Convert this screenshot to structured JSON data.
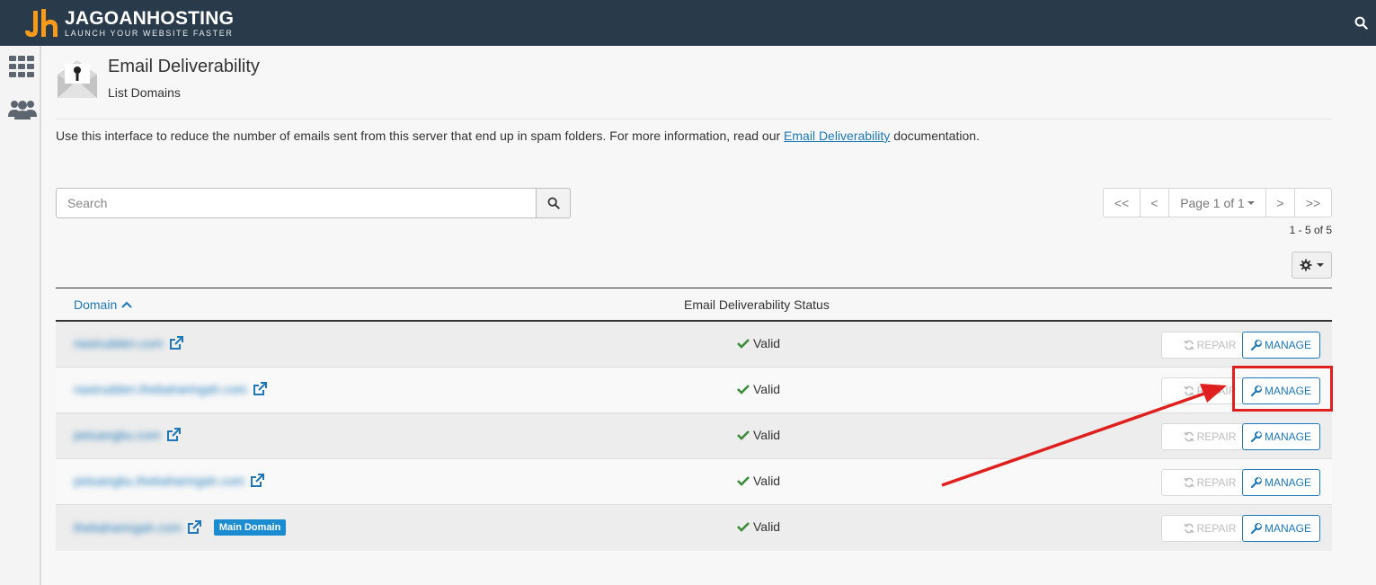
{
  "brand": {
    "name": "JAGOANHOSTING",
    "tagline": "LAUNCH YOUR WEBSITE FASTER",
    "accent": "#f59a1b"
  },
  "header": {
    "search_icon": "search-icon"
  },
  "sidebar": {
    "items": [
      {
        "icon": "apps-grid-icon"
      },
      {
        "icon": "users-icon"
      }
    ]
  },
  "page": {
    "icon": "email-key-icon",
    "title": "Email Deliverability",
    "subtitle": "List Domains",
    "intro_before": "Use this interface to reduce the number of emails sent from this server that end up in spam folders. For more information, read our ",
    "intro_link": "Email Deliverability",
    "intro_after": " documentation."
  },
  "search": {
    "placeholder": "Search",
    "value": ""
  },
  "pagination": {
    "first": "<<",
    "prev": "<",
    "page_label": "Page 1 of 1",
    "next": ">",
    "last": ">>",
    "range": "1 - 5 of 5"
  },
  "table": {
    "columns": {
      "domain": "Domain",
      "status": "Email Deliverability Status"
    },
    "rows": [
      {
        "domain": "nasirudden.com",
        "status": "Valid",
        "repair": "REPAIR",
        "manage": "MANAGE",
        "badge": ""
      },
      {
        "domain": "nasirudden.thebaharingah.com",
        "status": "Valid",
        "repair": "REPAIR",
        "manage": "MANAGE",
        "badge": ""
      },
      {
        "domain": "petuangbu.com",
        "status": "Valid",
        "repair": "REPAIR",
        "manage": "MANAGE",
        "badge": ""
      },
      {
        "domain": "petuangbu.thebaharingah.com",
        "status": "Valid",
        "repair": "REPAIR",
        "manage": "MANAGE",
        "badge": ""
      },
      {
        "domain": "thebaharingah.com",
        "status": "Valid",
        "repair": "REPAIR",
        "manage": "MANAGE",
        "badge": "Main Domain"
      }
    ]
  },
  "colors": {
    "topbar": "#293a4a",
    "link": "#1e78b8",
    "valid_check": "#3c8d3c",
    "annotation": "#e0201e",
    "badge": "#1b8ccf"
  }
}
